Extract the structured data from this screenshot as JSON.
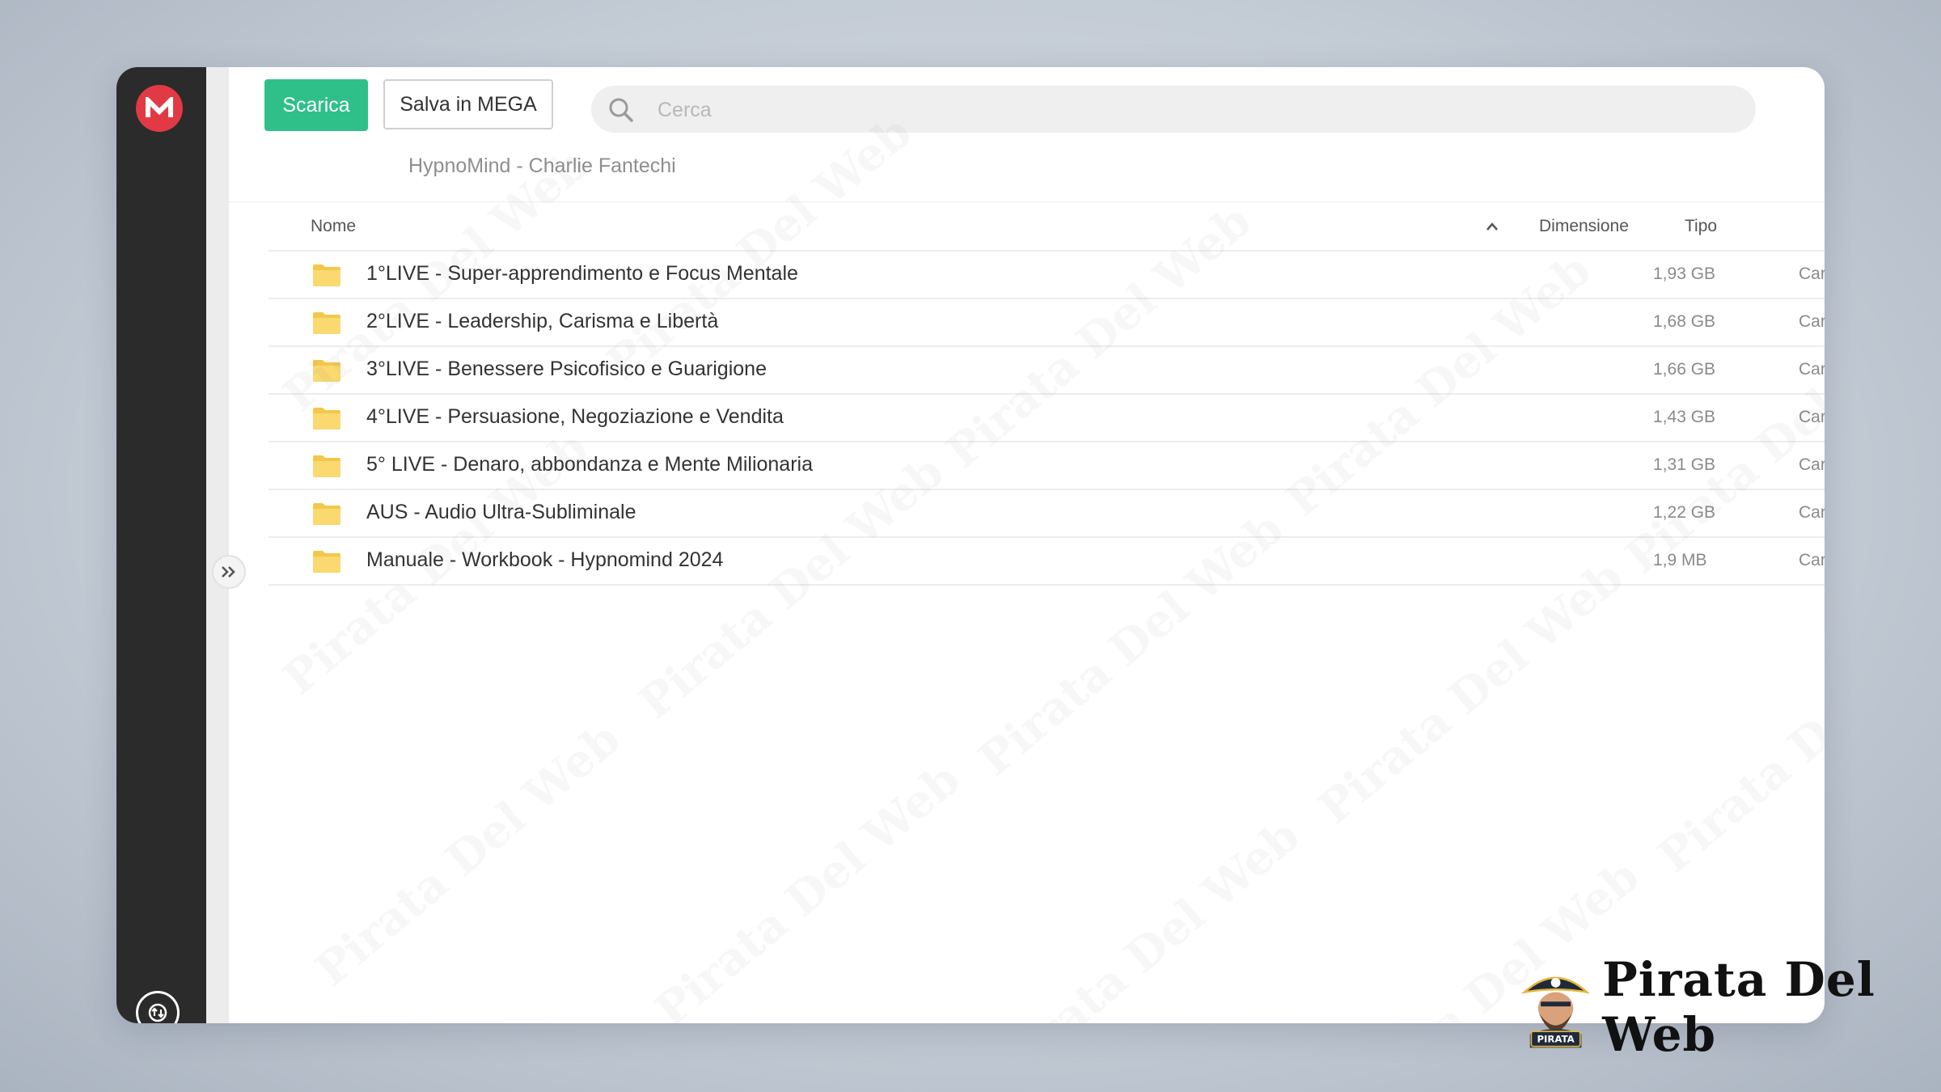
{
  "toolbar": {
    "download_label": "Scarica",
    "save_label": "Salva in MEGA"
  },
  "search": {
    "placeholder": "Cerca"
  },
  "breadcrumb": "HypnoMind - Charlie Fantechi",
  "table": {
    "headers": {
      "name": "Nome",
      "size": "Dimensione",
      "type": "Tipo"
    },
    "rows": [
      {
        "name": "1°LIVE - Super-apprendimento e Focus Mentale",
        "size": "1,93 GB",
        "type": "Cartella"
      },
      {
        "name": "2°LIVE - Leadership, Carisma e Libertà",
        "size": "1,68 GB",
        "type": "Cartella"
      },
      {
        "name": "3°LIVE - Benessere Psicofisico e Guarigione",
        "size": "1,66 GB",
        "type": "Cartella"
      },
      {
        "name": "4°LIVE - Persuasione, Negoziazione e Vendita",
        "size": "1,43 GB",
        "type": "Cartella"
      },
      {
        "name": "5° LIVE - Denaro, abbondanza e Mente Milionaria",
        "size": "1,31 GB",
        "type": "Cartella"
      },
      {
        "name": "AUS - Audio Ultra-Subliminale",
        "size": "1,22 GB",
        "type": "Cartella"
      },
      {
        "name": "Manuale - Workbook - Hypnomind 2024",
        "size": "1,9 MB",
        "type": "Cartella"
      }
    ]
  },
  "watermark_text": "Pirata Del Web",
  "brand": {
    "name": "Pirata Del Web",
    "badge": "PIRATA"
  },
  "icons": {
    "logo": "mega-logo-icon",
    "search": "search-icon",
    "folder": "folder-icon",
    "sort": "chevron-up-icon",
    "expand": "double-chevron-right-icon",
    "transfer": "transfer-icon"
  },
  "colors": {
    "accent": "#2fc08a",
    "brand_red": "#e23a44",
    "rail": "#2b2b2b",
    "folder": "#f7d46a"
  }
}
